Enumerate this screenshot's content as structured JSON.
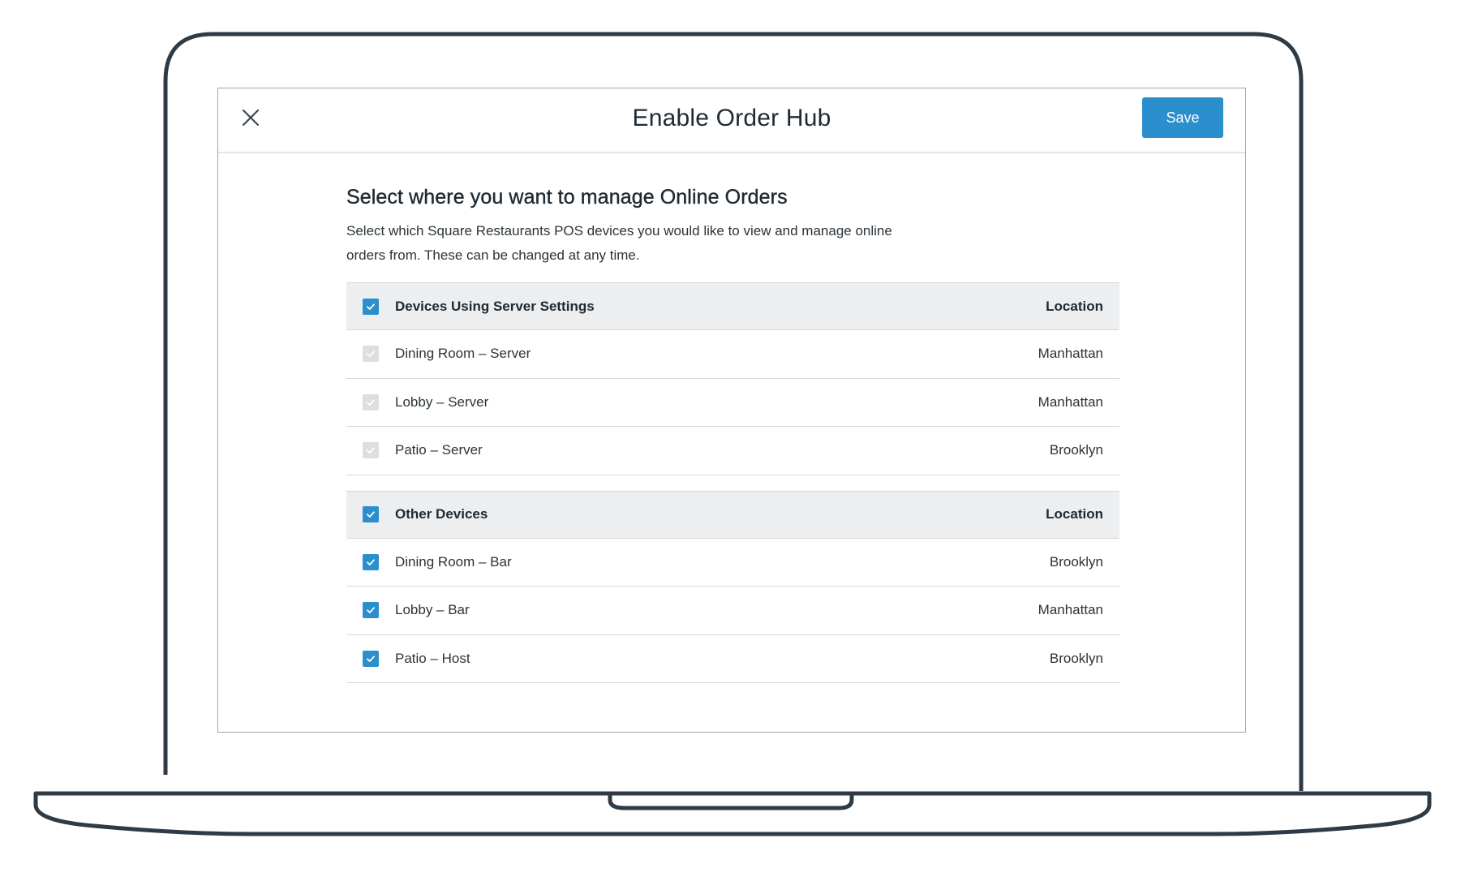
{
  "dialog": {
    "title": "Enable Order Hub",
    "save_label": "Save",
    "close_icon": "close-icon"
  },
  "content": {
    "heading": "Select where you want to manage Online Orders",
    "description": "Select which Square Restaurants POS devices you would like to view and manage online orders from. These can be changed at any time."
  },
  "colors": {
    "accent": "#2a8fcc",
    "header_bg": "#eceef0",
    "disabled_checkbox": "#dcdfe2",
    "laptop_outline": "#2e3b46"
  },
  "groups": [
    {
      "title": "Devices Using Server Settings",
      "location_header": "Location",
      "checked": true,
      "rows": [
        {
          "name": "Dining Room – Server",
          "location": "Manhattan",
          "checked": true,
          "disabled": true
        },
        {
          "name": "Lobby – Server",
          "location": "Manhattan",
          "checked": true,
          "disabled": true
        },
        {
          "name": "Patio – Server",
          "location": "Brooklyn",
          "checked": true,
          "disabled": true
        }
      ]
    },
    {
      "title": "Other Devices",
      "location_header": "Location",
      "checked": true,
      "rows": [
        {
          "name": "Dining Room – Bar",
          "location": "Brooklyn",
          "checked": true,
          "disabled": false
        },
        {
          "name": "Lobby – Bar",
          "location": "Manhattan",
          "checked": true,
          "disabled": false
        },
        {
          "name": "Patio – Host",
          "location": "Brooklyn",
          "checked": true,
          "disabled": false
        }
      ]
    }
  ]
}
